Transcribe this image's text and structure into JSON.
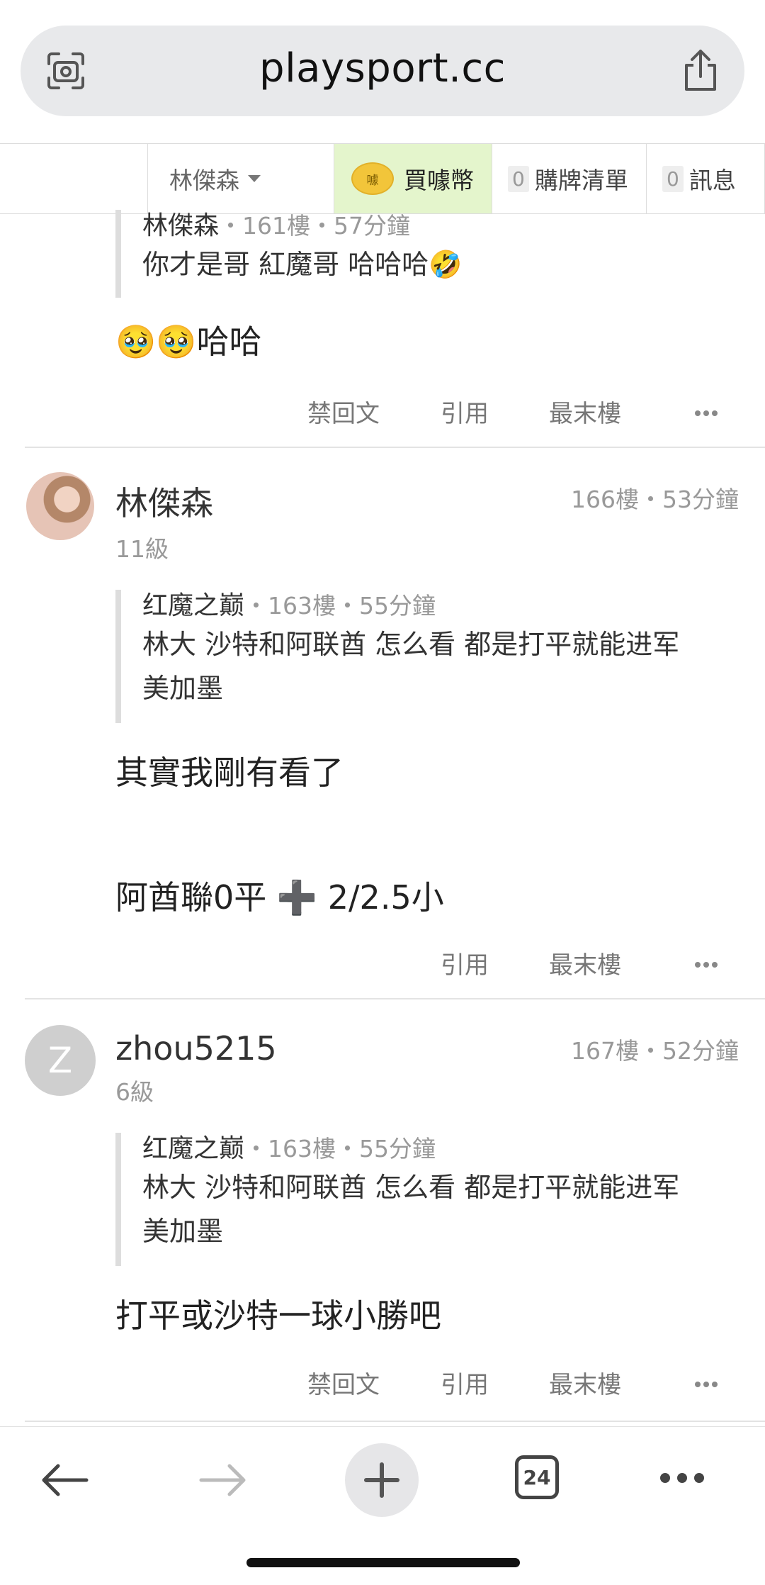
{
  "browser": {
    "url_host": "playsport.cc",
    "tab_count": "24"
  },
  "site_nav": {
    "username": "林傑森",
    "buy_coin_label": "買噱幣",
    "coin_badge": "噱",
    "cart_count": "0",
    "cart_label": "購牌清單",
    "msg_count": "0",
    "msg_label": "訊息"
  },
  "posts": [
    {
      "quote": {
        "author": "林傑森",
        "meta": "・161樓・57分鐘",
        "text": "你才是哥  紅魔哥  哈哈哈🤣"
      },
      "body": "🥹🥹哈哈",
      "actions": [
        "禁回文",
        "引用",
        "最末樓"
      ]
    },
    {
      "author": "林傑森",
      "level": "11級",
      "meta": "166樓・53分鐘",
      "quote": {
        "author": "红魔之巅",
        "meta": "・163樓・55分鐘",
        "text_line1": "林大 沙特和阿联酋 怎么看 都是打平就能进军",
        "text_line2": "美加墨"
      },
      "body_line1": "其實我剛有看了",
      "body_line2": "阿酋聯0平 ➕ 2/2.5小",
      "actions": [
        "引用",
        "最末樓"
      ]
    },
    {
      "author": "zhou5215",
      "avatar_letter": "Z",
      "level": "6級",
      "meta": "167樓・52分鐘",
      "quote": {
        "author": "红魔之巅",
        "meta": "・163樓・55分鐘",
        "text_line1": "林大 沙特和阿联酋 怎么看 都是打平就能进军",
        "text_line2": "美加墨"
      },
      "body": "打平或沙特一球小勝吧",
      "actions": [
        "禁回文",
        "引用",
        "最末樓"
      ]
    }
  ],
  "colors": {
    "nav_buy_bg": "#e4f5cc",
    "coin": "#f2c53a",
    "avatar_gray": "#cfcfcf"
  },
  "icons": [
    "lens-icon",
    "share-icon",
    "back-arrow-icon",
    "forward-arrow-icon",
    "plus-icon",
    "tabs-icon",
    "more-icon"
  ]
}
